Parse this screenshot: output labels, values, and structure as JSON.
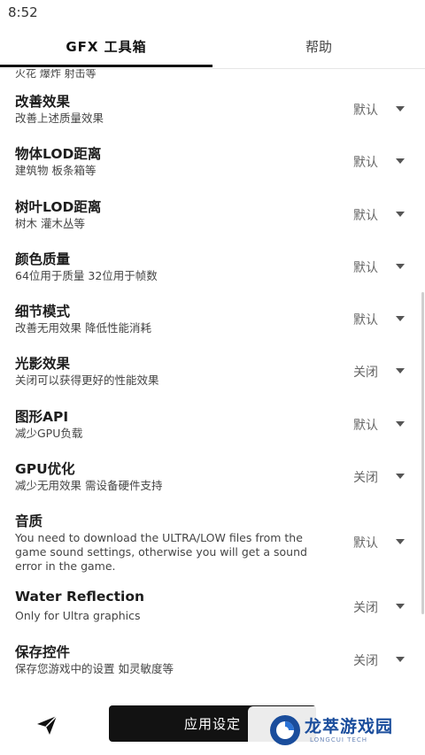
{
  "status_bar": {
    "time": "8:52"
  },
  "tabs": [
    {
      "label": "GFX 工具箱",
      "active": true
    },
    {
      "label": "帮助",
      "active": false
    }
  ],
  "partial_item_text": "火花 爆炸 射击等",
  "settings": [
    {
      "title": "改善效果",
      "desc": "改善上述质量效果",
      "value": "默认"
    },
    {
      "title": "物体LOD距离",
      "desc": "建筑物 板条箱等",
      "value": "默认"
    },
    {
      "title": "树叶LOD距离",
      "desc": "树木 灌木丛等",
      "value": "默认"
    },
    {
      "title": "颜色质量",
      "desc": "64位用于质量 32位用于帧数",
      "value": "默认"
    },
    {
      "title": "细节模式",
      "desc": "改善无用效果 降低性能消耗",
      "value": "默认"
    },
    {
      "title": "光影效果",
      "desc": "关闭可以获得更好的性能效果",
      "value": "关闭"
    },
    {
      "title": "图形API",
      "desc": "减少GPU负载",
      "value": "默认"
    },
    {
      "title": "GPU优化",
      "desc": "减少无用效果 需设备硬件支持",
      "value": "关闭"
    },
    {
      "title": "音质",
      "desc": "You need to download the ULTRA/LOW files from the game sound settings, otherwise you will get a sound error in the game.",
      "value": "默认"
    },
    {
      "title": "Water Reflection",
      "desc": "Only for Ultra graphics",
      "value": "关闭"
    },
    {
      "title": "保存控件",
      "desc": "保存您游戏中的设置 如灵敏度等",
      "value": "关闭"
    }
  ],
  "bottom_bar": {
    "apply_label": "应用设定",
    "send_icon": "send-icon"
  },
  "watermark": {
    "name": "龙萃游戏园",
    "sub": "LONGCUI TECH"
  },
  "colors": {
    "accent": "#121212",
    "watermark_blue": "#1a4d9c"
  }
}
